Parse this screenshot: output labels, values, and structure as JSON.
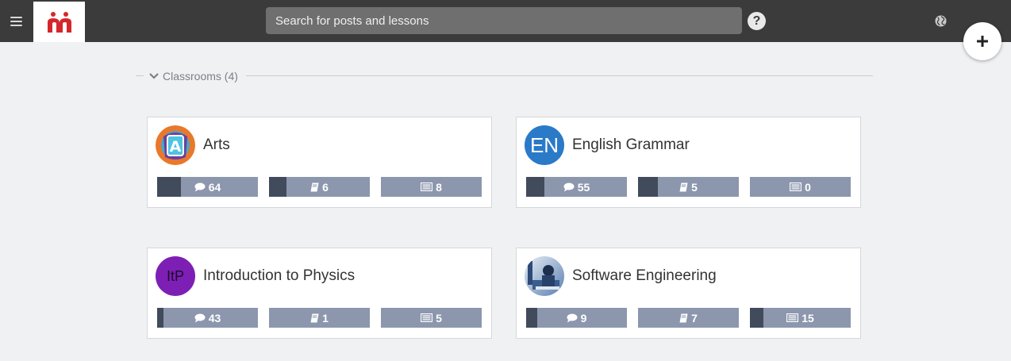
{
  "header": {
    "search_placeholder": "Search for posts and lessons",
    "help_glyph": "?",
    "fab_glyph": "+",
    "brand_color": "#d6262b"
  },
  "section": {
    "label": "Classrooms (4)"
  },
  "classrooms": [
    {
      "name": "Arts",
      "avatar": {
        "type": "image",
        "icon": "arts-a-badge-icon"
      },
      "stats": [
        {
          "icon": "comment-icon",
          "value": "64",
          "fill_pct": 24
        },
        {
          "icon": "book-icon",
          "value": "6",
          "fill_pct": 17
        },
        {
          "icon": "newspaper-icon",
          "value": "8",
          "fill_pct": 0
        }
      ]
    },
    {
      "name": "English Grammar",
      "avatar": {
        "type": "text",
        "text": "EN",
        "color": "#2a7ac8"
      },
      "stats": [
        {
          "icon": "comment-icon",
          "value": "55",
          "fill_pct": 18
        },
        {
          "icon": "book-icon",
          "value": "5",
          "fill_pct": 20
        },
        {
          "icon": "newspaper-icon",
          "value": "0",
          "fill_pct": 0
        }
      ]
    },
    {
      "name": "Introduction to Physics",
      "avatar": {
        "type": "text",
        "text": "ItP",
        "color": "#7d1fb5"
      },
      "stats": [
        {
          "icon": "comment-icon",
          "value": "43",
          "fill_pct": 6
        },
        {
          "icon": "book-icon",
          "value": "1",
          "fill_pct": 0
        },
        {
          "icon": "newspaper-icon",
          "value": "5",
          "fill_pct": 0
        }
      ]
    },
    {
      "name": "Software Engineering",
      "avatar": {
        "type": "image",
        "icon": "engineering-photo-icon"
      },
      "stats": [
        {
          "icon": "comment-icon",
          "value": "9",
          "fill_pct": 11
        },
        {
          "icon": "book-icon",
          "value": "7",
          "fill_pct": 0
        },
        {
          "icon": "newspaper-icon",
          "value": "15",
          "fill_pct": 13
        }
      ]
    }
  ]
}
